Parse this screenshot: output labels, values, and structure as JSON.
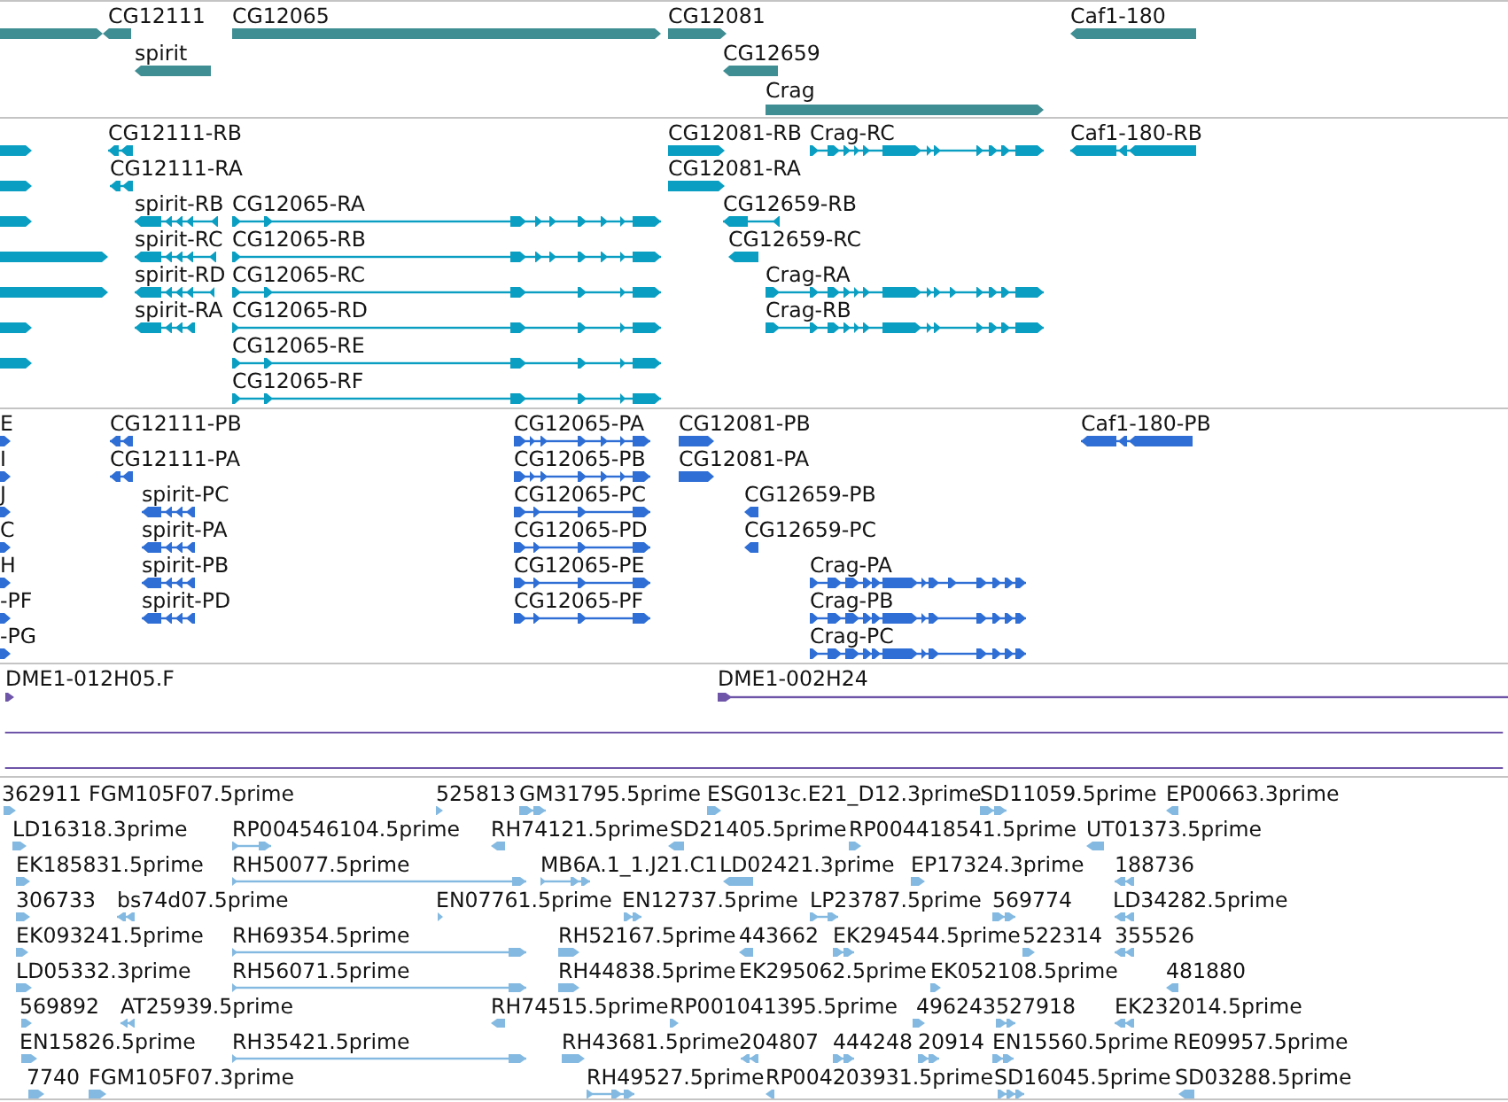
{
  "tracks": [
    {
      "kind": "gene",
      "features": [
        {
          "reverse": false
        },
        {
          "label": "CG12111",
          "reverse": true
        },
        {
          "label": "CG12065",
          "reverse": false
        },
        {
          "label": "CG12081",
          "reverse": false
        },
        {
          "label": "Caf1-180",
          "reverse": true
        },
        {
          "label": "spirit",
          "reverse": true
        },
        {
          "label": "CG12659",
          "reverse": true
        },
        {
          "label": "Crag",
          "reverse": false
        }
      ]
    },
    {
      "kind": "transcript",
      "features": [
        {
          "reverse": false
        },
        {
          "label": "CG12111-RB",
          "reverse": true
        },
        {
          "label": "CG12081-RB",
          "reverse": false
        },
        {
          "label": "Crag-RC",
          "reverse": false
        },
        {
          "label": "Caf1-180-RB",
          "reverse": true
        },
        {
          "reverse": false
        },
        {
          "label": "CG12111-RA",
          "reverse": true
        },
        {
          "label": "CG12081-RA",
          "reverse": false
        },
        {
          "reverse": false
        },
        {
          "label": "spirit-RB",
          "reverse": true
        },
        {
          "label": "CG12065-RA",
          "reverse": false
        },
        {
          "label": "CG12659-RB",
          "reverse": true
        },
        {
          "reverse": false
        },
        {
          "label": "spirit-RC",
          "reverse": true
        },
        {
          "label": "CG12065-RB",
          "reverse": false
        },
        {
          "label": "CG12659-RC",
          "reverse": true
        },
        {
          "reverse": false
        },
        {
          "label": "spirit-RD",
          "reverse": true
        },
        {
          "label": "CG12065-RC",
          "reverse": false
        },
        {
          "label": "Crag-RA",
          "reverse": false
        },
        {
          "reverse": false
        },
        {
          "label": "spirit-RA",
          "reverse": true
        },
        {
          "label": "CG12065-RD",
          "reverse": false
        },
        {
          "label": "Crag-RB",
          "reverse": false
        },
        {
          "reverse": false
        },
        {
          "label": "CG12065-RE",
          "reverse": false
        },
        {
          "label": "CG12065-RF",
          "reverse": false
        }
      ]
    },
    {
      "kind": "protein",
      "features": [
        {
          "label": "E",
          "reverse": false
        },
        {
          "label": "CG12111-PB",
          "reverse": true
        },
        {
          "label": "CG12065-PA",
          "reverse": false
        },
        {
          "label": "CG12081-PB",
          "reverse": false
        },
        {
          "label": "Caf1-180-PB",
          "reverse": true
        },
        {
          "label": "I",
          "reverse": false
        },
        {
          "label": "CG12111-PA",
          "reverse": true
        },
        {
          "label": "CG12065-PB",
          "reverse": false
        },
        {
          "label": "CG12081-PA",
          "reverse": false
        },
        {
          "label": "J",
          "reverse": false
        },
        {
          "label": "spirit-PC",
          "reverse": true
        },
        {
          "label": "CG12065-PC",
          "reverse": false
        },
        {
          "label": "CG12659-PB",
          "reverse": true
        },
        {
          "label": "C",
          "reverse": false
        },
        {
          "label": "spirit-PA",
          "reverse": true
        },
        {
          "label": "CG12065-PD",
          "reverse": false
        },
        {
          "label": "CG12659-PC",
          "reverse": true
        },
        {
          "label": "H",
          "reverse": false
        },
        {
          "label": "spirit-PB",
          "reverse": true
        },
        {
          "label": "CG12065-PE",
          "reverse": false
        },
        {
          "label": "Crag-PA",
          "reverse": false
        },
        {
          "label": "-PF",
          "reverse": false
        },
        {
          "label": "spirit-PD",
          "reverse": true
        },
        {
          "label": "CG12065-PF",
          "reverse": false
        },
        {
          "label": "Crag-PB",
          "reverse": false
        },
        {
          "label": "-PG",
          "reverse": false
        },
        {
          "label": "Crag-PC",
          "reverse": false
        }
      ]
    },
    {
      "kind": "cdna",
      "features": [
        {
          "kind": "alignment",
          "label": "DME1-012H05.F",
          "reverse": false
        },
        {
          "kind": "alignment",
          "label": "DME1-002H24",
          "reverse": false
        },
        {
          "kind": "span"
        },
        {
          "kind": "span"
        }
      ]
    },
    {
      "kind": "est",
      "features": [
        {
          "label": "362911",
          "reverse": false
        },
        {
          "label": "FGM105F07.5prime"
        },
        {
          "label": "525813",
          "reverse": false
        },
        {
          "label": "GM31795.5prime",
          "reverse": false
        },
        {
          "label": "ESG013c.E21_D12.3prime",
          "reverse": false
        },
        {
          "label": "SD11059.5prime",
          "reverse": false
        },
        {
          "label": "EP00663.3prime",
          "reverse": true
        },
        {
          "label": "LD16318.3prime",
          "reverse": false
        },
        {
          "label": "RP004546104.5prime",
          "reverse": false
        },
        {
          "label": "RH74121.5prime",
          "reverse": true
        },
        {
          "label": "SD21405.5prime",
          "reverse": true
        },
        {
          "label": "RP004418541.5prime",
          "reverse": false
        },
        {
          "label": "UT01373.5prime",
          "reverse": true
        },
        {
          "label": "EK185831.5prime",
          "reverse": false
        },
        {
          "label": "RH50077.5prime",
          "reverse": false
        },
        {
          "label": "MB6A.1_1.J21.C1",
          "reverse": false
        },
        {
          "label": "LD02421.3prime",
          "reverse": true
        },
        {
          "label": "EP17324.3prime",
          "reverse": false
        },
        {
          "label": "188736",
          "reverse": true
        },
        {
          "label": "306733",
          "reverse": false
        },
        {
          "label": "bs74d07.5prime",
          "reverse": true
        },
        {
          "label": "EN07761.5prime",
          "reverse": false
        },
        {
          "label": "EN12737.5prime",
          "reverse": false
        },
        {
          "label": "LP23787.5prime",
          "reverse": false
        },
        {
          "label": "569774",
          "reverse": false
        },
        {
          "label": "LD34282.5prime",
          "reverse": true
        },
        {
          "label": "EK093241.5prime",
          "reverse": false
        },
        {
          "label": "RH69354.5prime",
          "reverse": false
        },
        {
          "label": "RH52167.5prime",
          "reverse": false
        },
        {
          "label": "443662",
          "reverse": true
        },
        {
          "label": "EK294544.5prime",
          "reverse": false
        },
        {
          "label": "522314",
          "reverse": false
        },
        {
          "label": "355526",
          "reverse": true
        },
        {
          "label": "LD05332.3prime",
          "reverse": false
        },
        {
          "label": "RH56071.5prime",
          "reverse": false
        },
        {
          "label": "RH44838.5prime",
          "reverse": false
        },
        {
          "label": "EK295062.5prime"
        },
        {
          "label": "EK052108.5prime",
          "reverse": false
        },
        {
          "label": "481880",
          "reverse": true
        },
        {
          "label": "569892",
          "reverse": false
        },
        {
          "label": "AT25939.5prime",
          "reverse": true
        },
        {
          "label": "RH74515.5prime",
          "reverse": true
        },
        {
          "label": "RP001041395.5prime",
          "reverse": false
        },
        {
          "label": "496243",
          "reverse": false
        },
        {
          "label": "527918",
          "reverse": false
        },
        {
          "label": "EK232014.5prime",
          "reverse": true
        },
        {
          "label": "EN15826.5prime",
          "reverse": false
        },
        {
          "label": "RH35421.5prime",
          "reverse": false
        },
        {
          "label": "RH43681.5prime",
          "reverse": false
        },
        {
          "label": "204807",
          "reverse": true
        },
        {
          "label": "444248",
          "reverse": false
        },
        {
          "label": "20914",
          "reverse": false
        },
        {
          "label": "EN15560.5prime",
          "reverse": false
        },
        {
          "label": "RE09957.5prime"
        },
        {
          "label": "7740",
          "reverse": false
        },
        {
          "label": "FGM105F07.3prime",
          "reverse": false
        },
        {
          "label": "RH49527.5prime",
          "reverse": false
        },
        {
          "label": "RP004203931.5prime",
          "reverse": true
        },
        {
          "label": "SD16045.5prime",
          "reverse": false
        },
        {
          "label": "SD03288.5prime",
          "reverse": true
        }
      ]
    }
  ]
}
